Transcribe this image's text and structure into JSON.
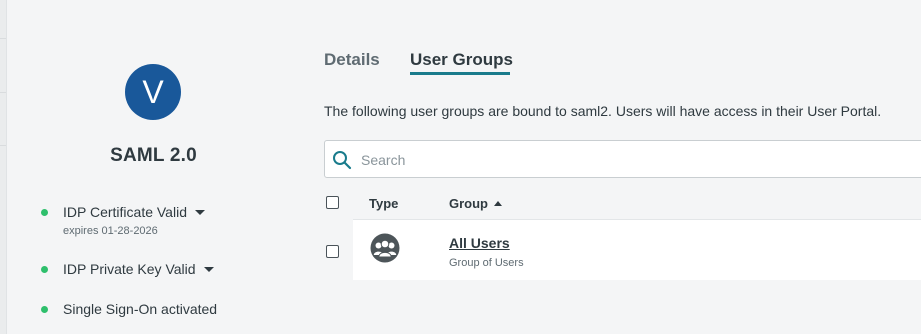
{
  "sidebar": {
    "app_avatar_letter": "V",
    "app_name": "SAML 2.0",
    "statuses": [
      {
        "label": "IDP Certificate Valid",
        "subtext": "expires 01-28-2026",
        "has_dropdown": true,
        "color": "#2ebf6c"
      },
      {
        "label": "IDP Private Key Valid",
        "has_dropdown": true,
        "color": "#2ebf6c"
      },
      {
        "label": "Single Sign-On activated",
        "has_dropdown": false,
        "color": "#2ebf6c"
      }
    ]
  },
  "main": {
    "tabs": [
      {
        "label": "Details",
        "active": false
      },
      {
        "label": "User Groups",
        "active": true
      }
    ],
    "description": "The following user groups are bound to saml2. Users will have access in their User Portal.",
    "search": {
      "placeholder": "Search",
      "value": "",
      "icon": "search-icon"
    },
    "table": {
      "columns": [
        "Type",
        "Group"
      ],
      "sort": {
        "column": "Group",
        "direction": "ascending"
      },
      "rows": [
        {
          "type_icon": "user-group-icon",
          "name": "All Users",
          "subtitle": "Group of Users",
          "selected": false
        }
      ]
    }
  },
  "colors": {
    "avatar_bg": "#19589a",
    "status_ok": "#2ebf6c",
    "tab_accent": "#197b8c",
    "search_icon": "#197b8c",
    "background": "#f4f5f6"
  }
}
